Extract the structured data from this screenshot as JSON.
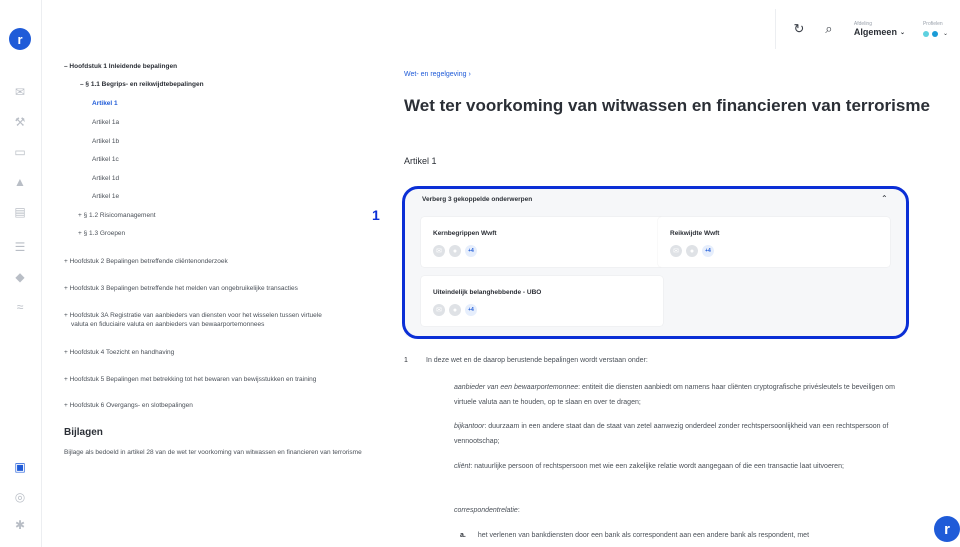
{
  "app": {
    "logo": "r"
  },
  "rail": {
    "items": [
      {
        "icon": "mail-icon",
        "glyph": "✉"
      },
      {
        "icon": "hammer-icon",
        "glyph": "⚒"
      },
      {
        "icon": "folder-icon",
        "glyph": "▭"
      },
      {
        "icon": "warning-icon",
        "glyph": "▲"
      },
      {
        "icon": "calendar-icon",
        "glyph": "▤"
      },
      {
        "icon": "checklist-icon",
        "glyph": "☰"
      },
      {
        "icon": "shield-icon",
        "glyph": "◆"
      },
      {
        "icon": "rss-icon",
        "glyph": "≈"
      },
      {
        "icon": "document-icon",
        "glyph": "▣"
      },
      {
        "icon": "layers-icon",
        "glyph": "◎"
      },
      {
        "icon": "settings-icon",
        "glyph": "✱"
      }
    ]
  },
  "topbar": {
    "refresh_glyph": "↻",
    "search_glyph": "⌕",
    "afdeling_caption": "Afdeling",
    "afdeling_value": "Algemeen",
    "profielen_caption": "Profielen",
    "chevron": "⌄",
    "profile_colors": [
      "#5ed1e0",
      "#1a9bd6"
    ]
  },
  "tree": {
    "ch1": "– Hoofdstuk 1 Inleidende bepalingen",
    "s11": "– § 1.1 Begrips- en reikwijdtebepalingen",
    "a1": "Artikel 1",
    "a1a": "Artikel 1a",
    "a1b": "Artikel 1b",
    "a1c": "Artikel 1c",
    "a1d": "Artikel 1d",
    "a1e": "Artikel 1e",
    "s12": "+ § 1.2 Risicomanagement",
    "s13": "+ § 1.3 Groepen",
    "ch2": "+ Hoofdstuk 2 Bepalingen betreffende cliëntenonderzoek",
    "ch3": "+ Hoofdstuk 3 Bepalingen betreffende het melden van ongebruikelijke transacties",
    "ch3a_l1": "+ Hoofdstuk 3A Registratie van aanbieders van diensten voor het wisselen tussen virtuele",
    "ch3a_l2": "valuta en fiduciaire valuta en aanbieders van bewaarportemonnees",
    "ch4": "+ Hoofdstuk 4 Toezicht en handhaving",
    "ch5": "+ Hoofdstuk 5 Bepalingen met betrekking tot het bewaren van bewijsstukken en training",
    "ch6": "+ Hoofdstuk 6 Overgangs- en slotbepalingen"
  },
  "bijlagen": {
    "heading": "Bijlagen",
    "text": "Bijlage als bedoeld in artikel 28 van de wet ter voorkoming van witwassen en financieren van terrorisme"
  },
  "main": {
    "breadcrumb": "Wet- en regelgeving  ›",
    "title": "Wet ter voorkoming van witwassen en financieren van terrorisme",
    "artikel": "Artikel 1"
  },
  "panel": {
    "header": "Verberg 3 gekoppelde onderwerpen",
    "chevron": "⌃",
    "marker": "1",
    "cards": [
      {
        "title": "Kernbegrippen Wwft",
        "more": "+4"
      },
      {
        "title": "Reikwijdte Wwft",
        "more": "+4"
      },
      {
        "title": "Uiteindelijk belanghebbende - UBO",
        "more": "+4"
      }
    ]
  },
  "content": {
    "num": "1",
    "intro": "In deze wet en de daarop berustende bepalingen wordt verstaan onder:",
    "d1_term": "aanbieder van een bewaarportemonnee",
    "d1_text": ": entiteit die diensten aanbiedt om namens haar cliënten cryptografische privésleutels te beveiligen om virtuele valuta aan te houden, op te slaan en over te dragen;",
    "d2_term": "bijkantoor",
    "d2_text": ": duurzaam in een andere staat dan de staat van zetel aanwezig onderdeel zonder rechtspersoonlijkheid van een rechtspersoon of vennootschap;",
    "d3_term": "cliënt",
    "d3_text": ": natuurlijke persoon of rechtspersoon met wie een zakelijke relatie wordt aangegaan of die een transactie laat uitvoeren;",
    "d4_term": "correspondentrelatie",
    "d4_text": ":",
    "sub_label": "a.",
    "sub_text": "het verlenen van bankdiensten door een bank als correspondent aan een andere bank als respondent, met"
  },
  "fab": {
    "glyph": "r"
  }
}
